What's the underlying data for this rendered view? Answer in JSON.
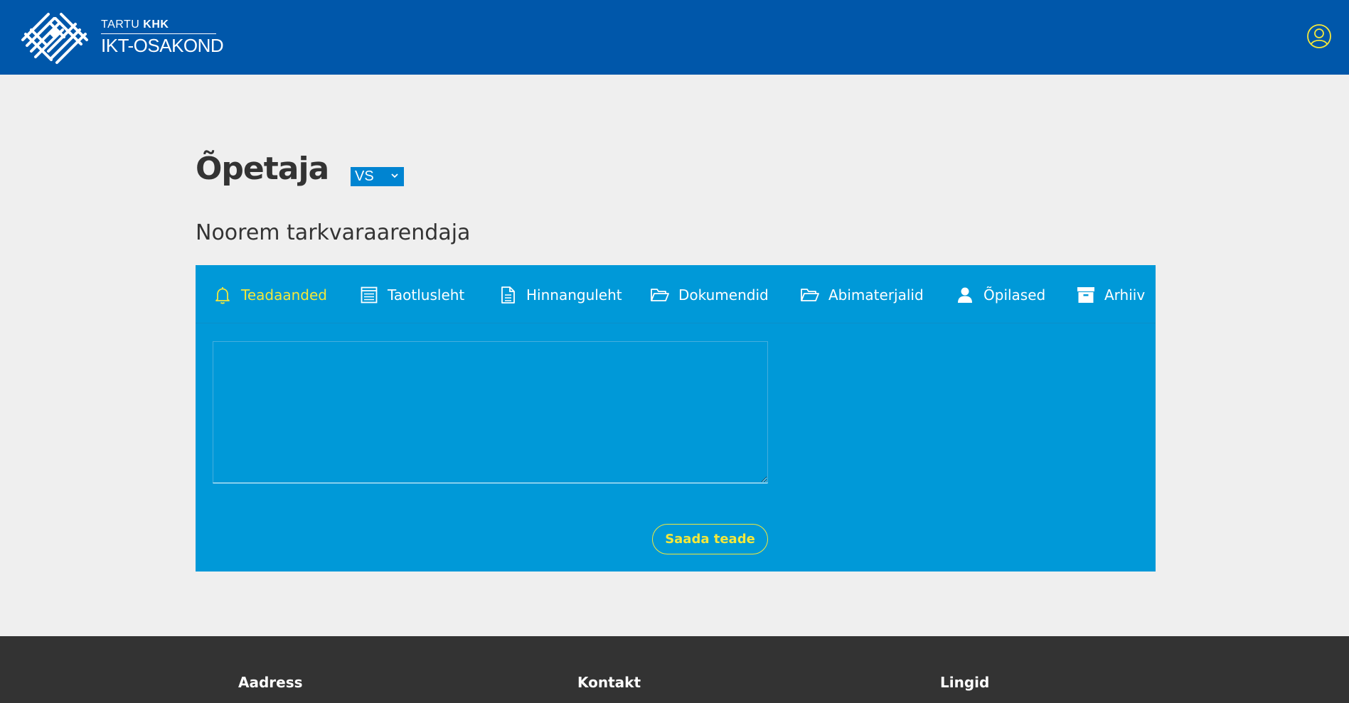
{
  "header": {
    "logo_top_prefix": "TARTU ",
    "logo_top_bold": "KHK",
    "logo_bottom": "IKT-OSAKOND",
    "user_icon": "user-circle-icon",
    "background_color": "#0057aa"
  },
  "main": {
    "title": "Õpetaja",
    "group_select": {
      "selected": "VS",
      "icon": "chevron-down-icon"
    },
    "subtitle": "Noorem tarkvaraarendaja",
    "panel_color": "#0099d8",
    "accent_color": "#f4e83a"
  },
  "tabs": [
    {
      "label": "Teadaanded",
      "icon": "bell-icon",
      "active": true
    },
    {
      "label": "Taotlusleht",
      "icon": "form-list-icon",
      "active": false
    },
    {
      "label": "Hinnanguleht",
      "icon": "document-icon",
      "active": false
    },
    {
      "label": "Dokumendid",
      "icon": "folder-open-icon",
      "active": false
    },
    {
      "label": "Abimaterjalid",
      "icon": "folder-open-icon",
      "active": false
    },
    {
      "label": "Õpilased",
      "icon": "user-icon",
      "active": false
    },
    {
      "label": "Arhiiv",
      "icon": "archive-box-icon",
      "active": false
    }
  ],
  "form": {
    "message_value": "",
    "send_label": "Saada teade"
  },
  "footer": {
    "columns": [
      "Aadress",
      "Kontakt",
      "Lingid"
    ]
  }
}
